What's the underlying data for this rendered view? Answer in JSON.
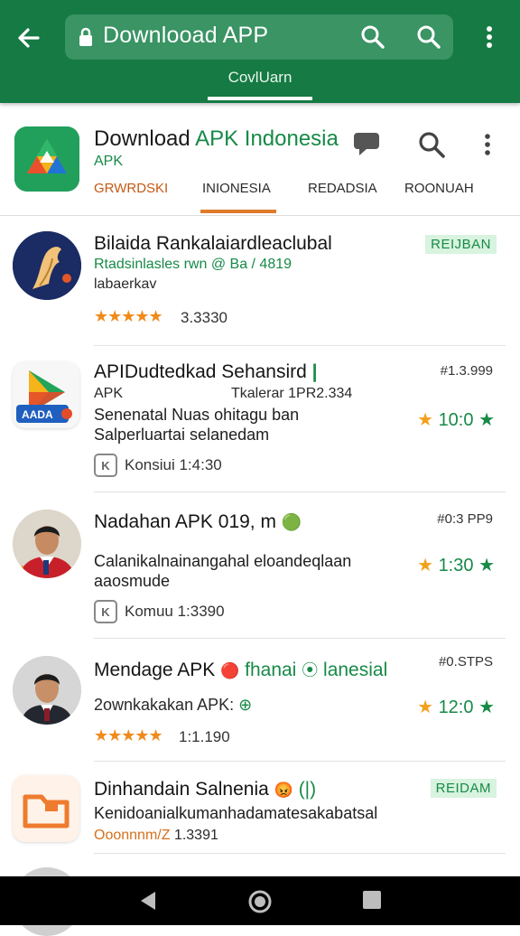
{
  "appbar": {
    "url_text": "Downlooad  APP",
    "tab_label": "CovlUarn"
  },
  "app_header": {
    "title_main": "Download ",
    "title_accent": "APK Indonesia",
    "subtitle": "APK",
    "tabs": [
      "GRWRDSKI",
      "INIONESIA",
      "REDADSIA",
      "ROONUAH"
    ],
    "active_tab_index": 1
  },
  "items": [
    {
      "title": "Bilaida Rankalaiardleaclubal",
      "line1": "Rtadsinlasles rwn @ Ba / 4819",
      "line2": "labaerkav",
      "rating": "3.3330",
      "badge": "REIJBAN"
    },
    {
      "title": "APIDudtedkad Sehansird",
      "line1": "APK",
      "line1_right": "Tkalerar 1PR2.334",
      "desc": "Senenatal Nuas ohitagu ban Salperluartai selanedam",
      "chip_text": "Konsiui 1:4:30",
      "meta": "#1.3.999",
      "rating_right": "10:0"
    },
    {
      "title": "Nadahan APK 019, m",
      "desc": "Calanikalnainangahal eloandeqlaan aaosmude",
      "chip_text": "Komuu 1:3390",
      "meta": "#0:3 PP9",
      "rating_right": "1:30"
    },
    {
      "title_a": "Mendage APK",
      "title_b": "fhanai",
      "title_c": "lanesial",
      "line1": "2ownkakakan APK:",
      "rating": "1:1.190",
      "meta": "#0.STPS",
      "rating_right": "12:0"
    },
    {
      "title": "Dinhandain Salnenia",
      "desc": "Kenidoanialkumanhadamatesakabatsal",
      "chip_text_a": "Ooonnnm/Z",
      "chip_text_b": "1.3391",
      "badge": "REIDAM"
    }
  ],
  "colors": {
    "primary_green": "#157a43",
    "accent_green": "#178a47",
    "accent_orange": "#e07b2a",
    "star_orange": "#f08a1a"
  },
  "icons": [
    "back-arrow-icon",
    "lock-icon",
    "search-icon",
    "more-vert-icon",
    "chat-icon",
    "star-icon",
    "nav-back-icon",
    "nav-home-icon",
    "nav-recent-icon"
  ]
}
